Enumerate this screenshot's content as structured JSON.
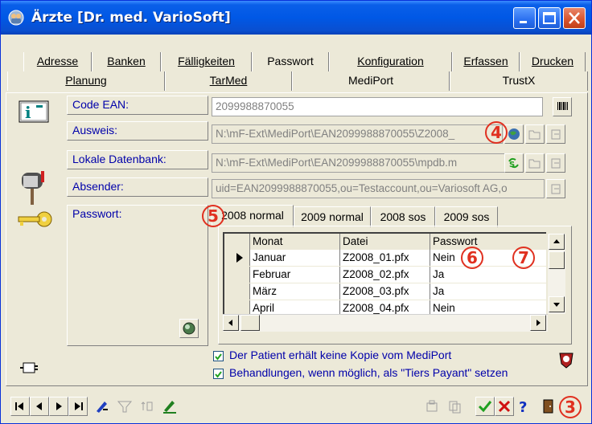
{
  "window": {
    "title": "Ärzte [Dr. med. VarioSoft]"
  },
  "tabs_row1": [
    {
      "label": "Adresse",
      "underline": "A"
    },
    {
      "label": "Banken",
      "underline": "B"
    },
    {
      "label": "Fälligkeiten",
      "underline": "F"
    },
    {
      "label": "Passwort",
      "underline": "s"
    },
    {
      "label": "Konfiguration",
      "underline": "K"
    },
    {
      "label": "Erfassen",
      "underline": "E"
    },
    {
      "label": "Drucken",
      "underline": "D"
    }
  ],
  "tabs_row2": [
    {
      "label": "Planung",
      "underline": "P"
    },
    {
      "label": "TarMed",
      "underline": "T"
    },
    {
      "label": "MediPort",
      "underline": "M"
    },
    {
      "label": "TrustX",
      "underline": "X"
    }
  ],
  "active_tab": "MediPort",
  "fields": {
    "code_ean_label": "Code EAN:",
    "code_ean_value": "2099988870055",
    "ausweis_label": "Ausweis:",
    "ausweis_value": "N:\\mF-Ext\\MediPort\\EAN2099988870055\\Z2008_",
    "lokale_db_label": "Lokale Datenbank:",
    "lokale_db_value": "N:\\mF-Ext\\MediPort\\EAN2099988870055\\mpdb.m",
    "absender_label": "Absender:",
    "absender_value": "uid=EAN2099988870055,ou=Testaccount,ou=Variosoft AG,o",
    "passwort_label": "Passwort:"
  },
  "subtabs": [
    "2008 normal",
    "2009 normal",
    "2008 sos",
    "2009 sos"
  ],
  "active_subtab": "2008 normal",
  "grid": {
    "columns": [
      "Monat",
      "Datei",
      "Passwort"
    ],
    "rows": [
      {
        "monat": "Januar",
        "datei": "Z2008_01.pfx",
        "passwort": "Nein",
        "current": true
      },
      {
        "monat": "Februar",
        "datei": "Z2008_02.pfx",
        "passwort": "Ja"
      },
      {
        "monat": "März",
        "datei": "Z2008_03.pfx",
        "passwort": "Ja"
      },
      {
        "monat": "April",
        "datei": "Z2008_04.pfx",
        "passwort": "Nein"
      }
    ]
  },
  "checkboxes": [
    {
      "label": "Der Patient erhält keine Kopie vom MediPort",
      "checked": true
    },
    {
      "label": "Behandlungen, wenn möglich, als \"Tiers Payant\" setzen",
      "checked": true
    }
  ],
  "callouts": [
    "3",
    "4",
    "5",
    "6",
    "7"
  ],
  "colors": {
    "titlebar": "#0058E6",
    "label_text": "#0000AA",
    "callout": "#E03020",
    "ok_green": "#1FA01F",
    "cancel_red": "#D01010"
  }
}
